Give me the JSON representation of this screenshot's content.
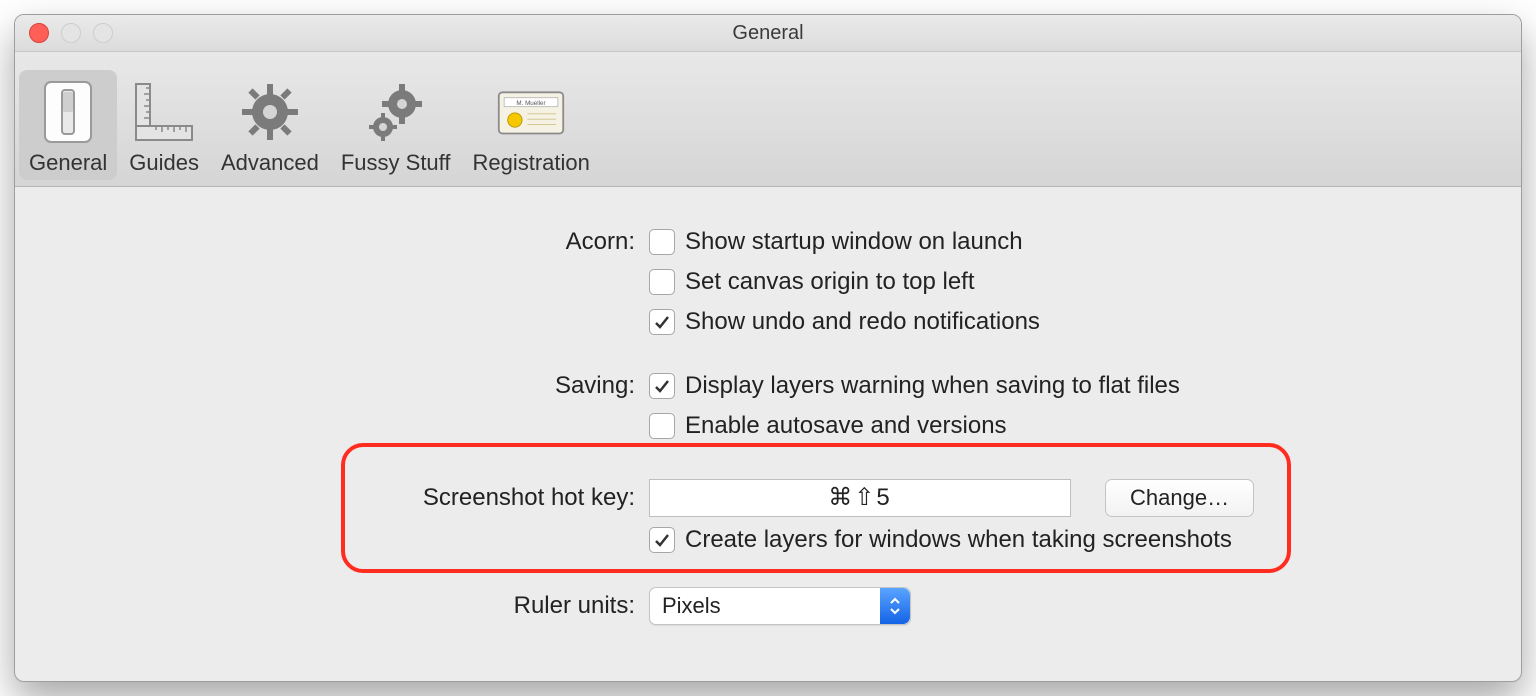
{
  "window": {
    "title": "General"
  },
  "toolbar": {
    "tabs": [
      {
        "label": "General"
      },
      {
        "label": "Guides"
      },
      {
        "label": "Advanced"
      },
      {
        "label": "Fussy Stuff"
      },
      {
        "label": "Registration"
      }
    ],
    "registration_badge_text": "M. Mueller"
  },
  "sections": {
    "acorn": {
      "label": "Acorn:",
      "options": [
        {
          "label": "Show startup window on launch",
          "checked": false
        },
        {
          "label": "Set canvas origin to top left",
          "checked": false
        },
        {
          "label": "Show undo and redo notifications",
          "checked": true
        }
      ]
    },
    "saving": {
      "label": "Saving:",
      "options": [
        {
          "label": "Display layers warning when saving to flat files",
          "checked": true
        },
        {
          "label": "Enable autosave and versions",
          "checked": false
        }
      ]
    },
    "screenshot": {
      "label": "Screenshot hot key:",
      "hotkey": "⌘⇧5",
      "change_button": "Change…",
      "create_layers": {
        "label": "Create layers for windows when taking screenshots",
        "checked": true
      }
    },
    "ruler": {
      "label": "Ruler units:",
      "value": "Pixels"
    }
  }
}
